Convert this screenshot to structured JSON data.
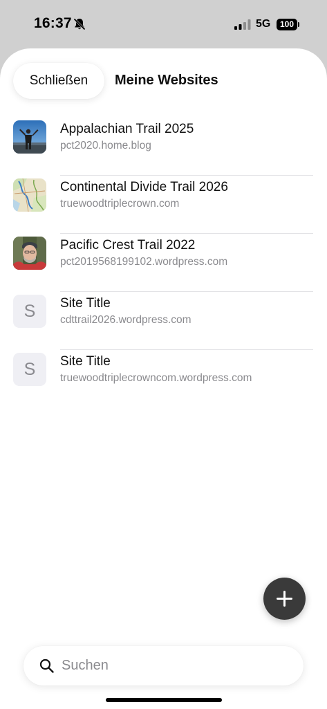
{
  "status_bar": {
    "time": "16:37",
    "network": "5G",
    "battery": "100",
    "icons": [
      "bell-slash-icon",
      "cellular-signal-icon",
      "battery-icon"
    ]
  },
  "header": {
    "close_label": "Schließen",
    "title": "Meine Websites"
  },
  "sites": [
    {
      "name": "Appalachian Trail 2025",
      "url": "pct2020.home.blog",
      "icon": "hiker-photo"
    },
    {
      "name": "Continental Divide Trail 2026",
      "url": "truewoodtriplecrown.com",
      "icon": "trail-map-photo"
    },
    {
      "name": "Pacific Crest Trail 2022",
      "url": "pct2019568199102.wordpress.com",
      "icon": "portrait-photo"
    },
    {
      "name": "Site Title",
      "url": "cdttrail2026.wordpress.com",
      "icon_letter": "S"
    },
    {
      "name": "Site Title",
      "url": "truewoodtriplecrowncom.wordpress.com",
      "icon_letter": "S"
    }
  ],
  "search": {
    "placeholder": "Suchen",
    "value": ""
  },
  "colors": {
    "backdrop": "#d0d0d0",
    "fab": "#3a3a3a",
    "secondary_text": "#8a8a8e",
    "letter_icon_bg": "#efeff4"
  }
}
